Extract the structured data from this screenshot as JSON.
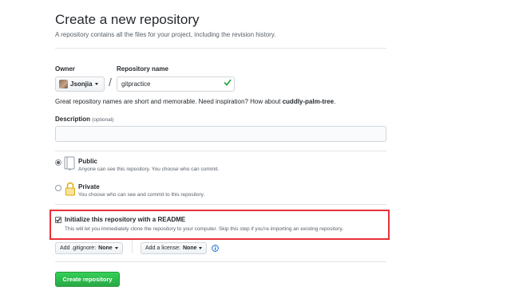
{
  "header": {
    "title": "Create a new repository",
    "subtitle": "A repository contains all the files for your project, including the revision history."
  },
  "owner": {
    "label": "Owner",
    "value": "Jsonjia"
  },
  "repository": {
    "label": "Repository name",
    "value": "gitpractice",
    "separator": "/"
  },
  "hint": {
    "text": "Great repository names are short and memorable. Need inspiration? How about ",
    "suggestion": "cuddly-palm-tree",
    "end": "."
  },
  "description": {
    "label": "Description",
    "optional": "(optional)",
    "value": ""
  },
  "visibility": {
    "selected": "public",
    "public": {
      "title": "Public",
      "desc": "Anyone can see this repository. You choose who can commit."
    },
    "private": {
      "title": "Private",
      "desc": "You choose who can see and commit to this repository."
    }
  },
  "readme": {
    "checked": true,
    "title": "Initialize this repository with a README",
    "desc": "This will let you immediately clone the repository to your computer. Skip this step if you're importing an existing repository."
  },
  "gitignore": {
    "prefix": "Add .gitignore:",
    "value": "None"
  },
  "license": {
    "prefix": "Add a license:",
    "value": "None"
  },
  "create_button": "Create repository",
  "colors": {
    "success_check": "#28a745",
    "highlight_box": "#e8303a",
    "create_button": "#28a745",
    "info_icon": "#0366d6"
  },
  "icons": [
    "caret-down-icon",
    "checkmark-icon",
    "repo-book-icon",
    "lock-icon",
    "info-icon"
  ]
}
